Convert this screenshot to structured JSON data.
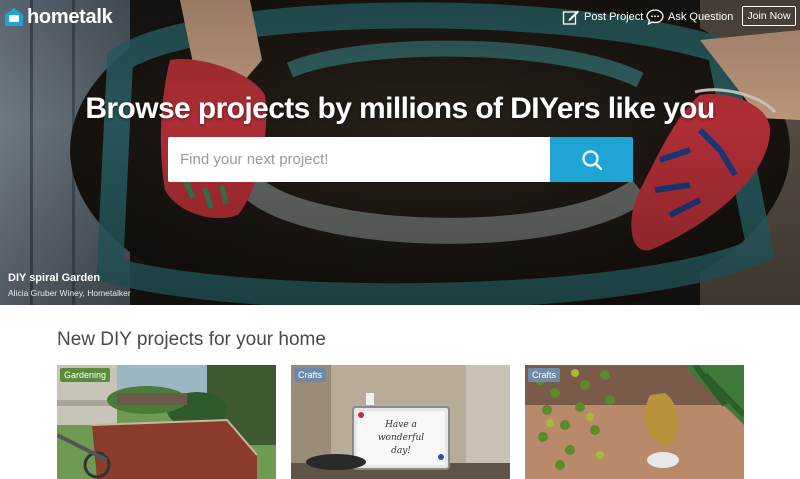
{
  "brand": {
    "name": "hometalk",
    "accent": "#1ea5d6"
  },
  "nav": {
    "post_project": "Post Project",
    "ask_question": "Ask Question",
    "join_now": "Join Now"
  },
  "hero": {
    "headline": "Browse projects by millions of DIYers like you",
    "search_placeholder": "Find your next project!",
    "photo_title": "DIY spiral Garden",
    "photo_author": "Alicia Gruber Winey, Hometalker"
  },
  "section": {
    "title": "New DIY projects for your home",
    "cards": [
      {
        "category": "Gardening",
        "tag_color": "#5a8a3c"
      },
      {
        "category": "Crafts",
        "tag_color": "#6f8aa8"
      },
      {
        "category": "Crafts",
        "tag_color": "#6f8aa8"
      }
    ]
  },
  "whiteboard_text": [
    "Have a",
    "wonderful",
    "day!"
  ],
  "icons": {
    "logo": "house-icon",
    "post": "pencil-square-icon",
    "ask": "speech-bubble-icon",
    "search": "search-icon"
  }
}
